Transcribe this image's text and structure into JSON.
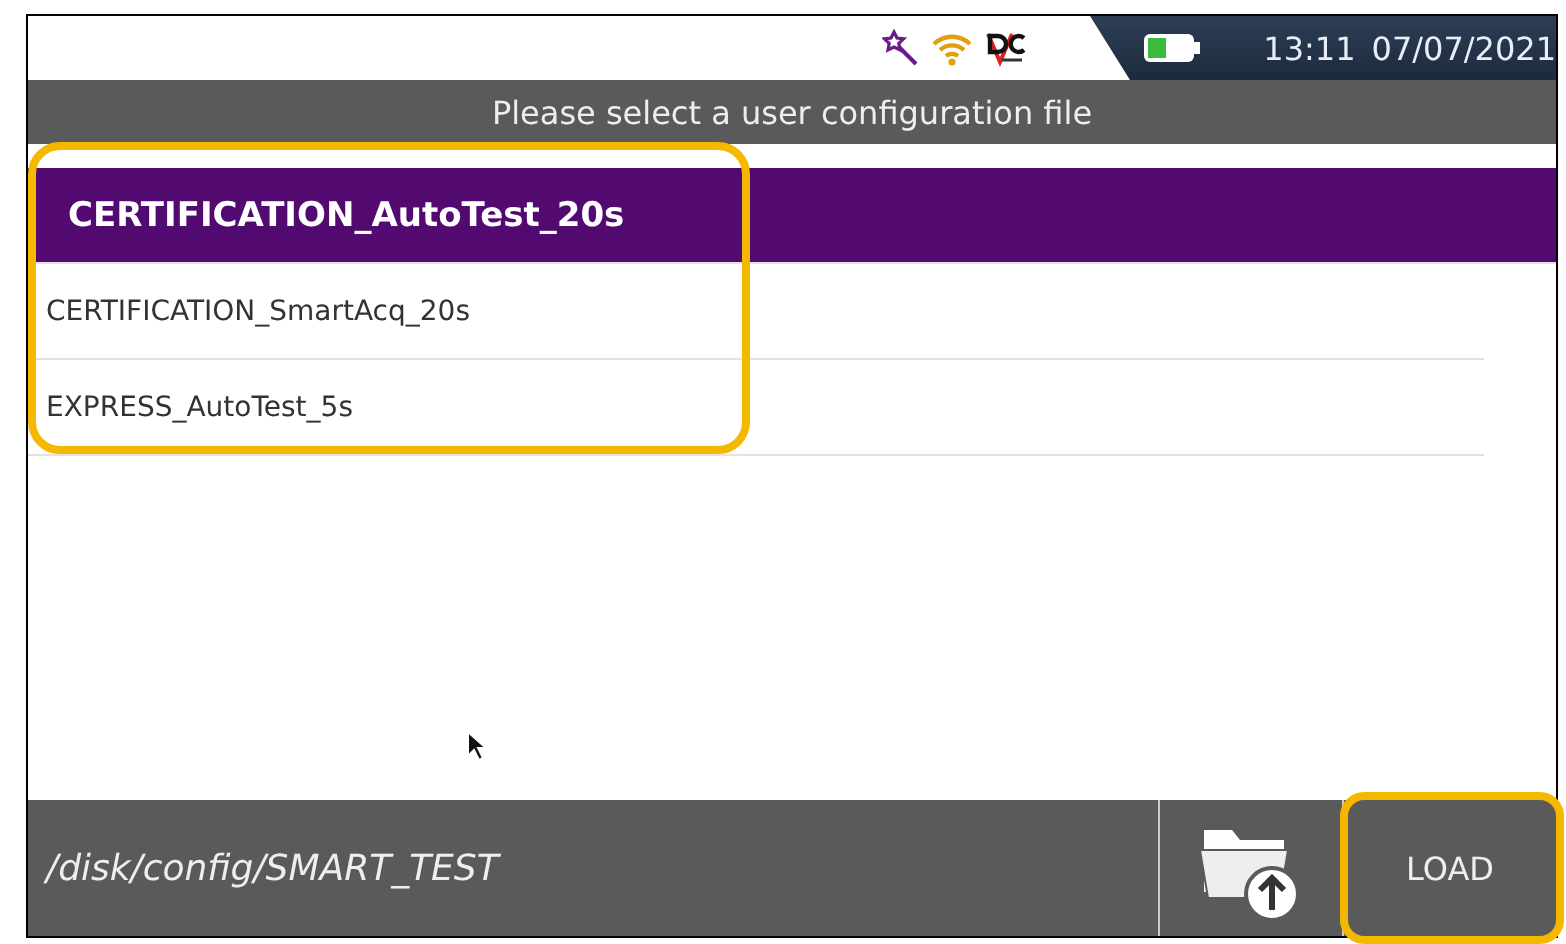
{
  "status_bar": {
    "time": "13:11",
    "date": "07/07/2021"
  },
  "header": {
    "title": "Please select a user configuration file"
  },
  "files": [
    {
      "name": "CERTIFICATION_AutoTest_20s",
      "selected": true
    },
    {
      "name": "CERTIFICATION_SmartAcq_20s",
      "selected": false
    },
    {
      "name": "EXPRESS_AutoTest_5s",
      "selected": false
    }
  ],
  "footer": {
    "path": "/disk/config/SMART_TEST",
    "button": "LOAD"
  }
}
